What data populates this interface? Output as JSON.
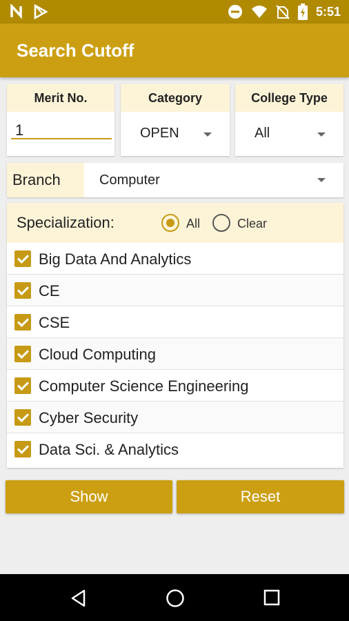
{
  "status_bar": {
    "time": "5:51",
    "icons": [
      "n-notification-icon",
      "play-store-icon",
      "do-not-disturb-icon",
      "wifi-icon",
      "no-sim-icon",
      "battery-charging-icon"
    ]
  },
  "app_bar": {
    "title": "Search Cutoff"
  },
  "merit": {
    "label": "Merit No.",
    "value": "1"
  },
  "category": {
    "label": "Category",
    "value": "OPEN"
  },
  "college_type": {
    "label": "College Type",
    "value": "All"
  },
  "branch": {
    "label": "Branch",
    "value": "Computer"
  },
  "specialization": {
    "label": "Specialization:",
    "option_all": "All",
    "option_clear": "Clear",
    "selected": "All",
    "items": [
      {
        "label": "Big Data And Analytics",
        "checked": true
      },
      {
        "label": "CE",
        "checked": true
      },
      {
        "label": "CSE",
        "checked": true
      },
      {
        "label": "Cloud Computing",
        "checked": true
      },
      {
        "label": "Computer Science Engineering",
        "checked": true
      },
      {
        "label": "Cyber Security",
        "checked": true
      },
      {
        "label": "Data Sci. & Analytics",
        "checked": true
      }
    ]
  },
  "buttons": {
    "show": "Show",
    "reset": "Reset"
  },
  "colors": {
    "primary": "#cc9f12",
    "primary_dark": "#b08a00",
    "header_tint": "#fdf4d8",
    "accent": "#c79a16"
  }
}
